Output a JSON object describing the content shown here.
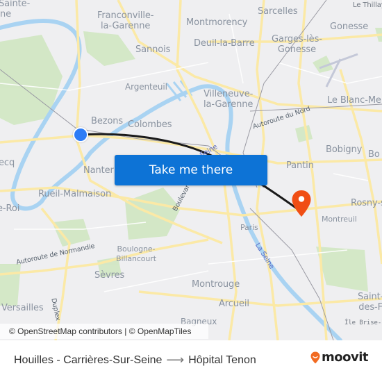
{
  "map": {
    "labels": {
      "sainte": "Sainte-",
      "ne": "ne",
      "franconville": "Franconville-\nla-Garenne",
      "sannois": "Sannois",
      "montmorency": "Montmorency",
      "deuil": "Deuil-la-Barre",
      "sarcelles": "Sarcelles",
      "garges": "Garges-lès-\nGonesse",
      "gonesse": "Gonesse",
      "le_thillay": "Le Thillay",
      "argenteuil": "Argenteuil",
      "villeneuve": "Villeneuve-\nla-Garenne",
      "le_blanc_mesnil": "Le Blanc-Me",
      "bezons": "Bezons",
      "colombes": "Colombes",
      "autoroute_du_nord": "Autoroute du Nord",
      "bobigny": "Bobigny",
      "bo": "Bo",
      "ecq": "ecq",
      "nanterre": "Nanter",
      "pantin": "Pantin",
      "rueil": "Rueil-Malmaison",
      "le_roi": "e-Roi",
      "rosny": "Rosny-s",
      "montreuil": "Montreuil",
      "paris": "Paris",
      "la_seine": "La Seine",
      "seine": "Seine",
      "boulevard": "Boulevard",
      "boulogne": "Boulogne-\nBillancourt",
      "autoroute_normandie": "Autoroute de Normandie",
      "sevres": "Sèvres",
      "montrouge": "Montrouge",
      "arcueil": "Arcueil",
      "bagneux": "Bagneux",
      "versailles": "Versailles",
      "duplex": "Duplex",
      "saint_denis": "Saint-\ndes-F",
      "ile_brise": "Île Brise-P"
    },
    "cta_label": "Take me there",
    "attribution": "© OpenStreetMap contributors | © OpenMapTiles",
    "origin_marker_color": "#2d7cf6",
    "destination_marker_color": "#f04e14"
  },
  "footer": {
    "origin": "Houilles - Carrières-Sur-Seine",
    "arrow": "⟶",
    "destination": "Hôpital Tenon",
    "brand": "moovit",
    "brand_color": "#f26b21"
  }
}
